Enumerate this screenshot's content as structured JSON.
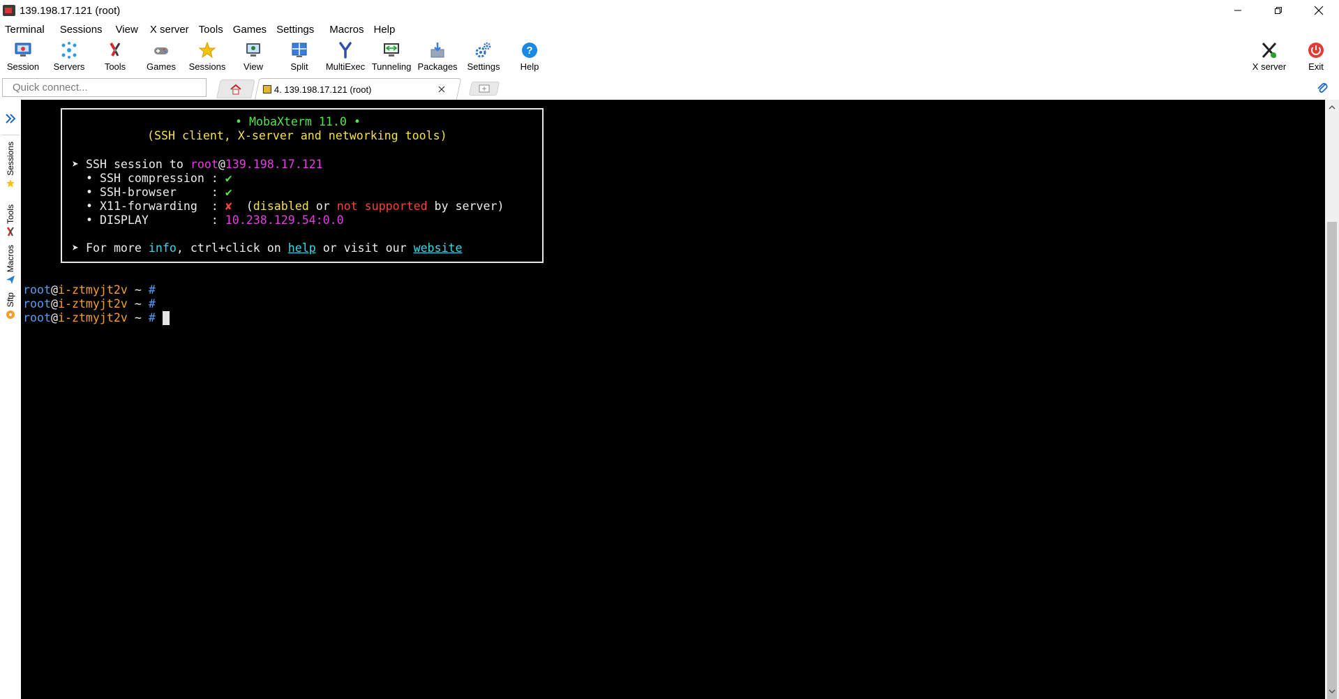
{
  "window": {
    "title": "139.198.17.121 (root)"
  },
  "menu": [
    "Terminal",
    "Sessions",
    "View",
    "X server",
    "Tools",
    "Games",
    "Settings",
    "Macros",
    "Help"
  ],
  "toolbar": {
    "left": [
      {
        "label": "Session",
        "icon": "session-icon"
      },
      {
        "label": "Servers",
        "icon": "servers-icon"
      },
      {
        "label": "Tools",
        "icon": "tools-icon"
      },
      {
        "label": "Games",
        "icon": "games-icon"
      },
      {
        "label": "Sessions",
        "icon": "star-icon"
      },
      {
        "label": "View",
        "icon": "view-icon"
      },
      {
        "label": "Split",
        "icon": "split-icon"
      },
      {
        "label": "MultiExec",
        "icon": "multiexec-icon"
      },
      {
        "label": "Tunneling",
        "icon": "tunneling-icon"
      },
      {
        "label": "Packages",
        "icon": "packages-icon"
      },
      {
        "label": "Settings",
        "icon": "settings-icon"
      },
      {
        "label": "Help",
        "icon": "help-icon"
      }
    ],
    "right": [
      {
        "label": "X server",
        "icon": "x-server-icon"
      },
      {
        "label": "Exit",
        "icon": "power-icon"
      }
    ]
  },
  "quick_connect": {
    "placeholder": "Quick connect..."
  },
  "tabs": {
    "active_title": "4. 139.198.17.121 (root)"
  },
  "sidebar": [
    "Sessions",
    "Tools",
    "Macros",
    "Sftp"
  ],
  "terminal": {
    "banner": {
      "title": "• MobaXterm 11.0 •",
      "subtitle": "(SSH client, X-server and networking tools)",
      "session_prefix": "➤ SSH session to ",
      "session_user": "root",
      "session_at": "@",
      "session_host": "139.198.17.121",
      "compression_label": "  • SSH compression : ",
      "compression_value": "✔",
      "browser_label": "  • SSH-browser     : ",
      "browser_value": "✔",
      "x11_label": "  • X11-forwarding  : ",
      "x11_value": "✘",
      "x11_note_open": "  (",
      "x11_note_disabled": "disabled",
      "x11_note_or": " or ",
      "x11_note_not_supported": "not supported",
      "x11_note_close": " by server)",
      "display_label": "  • DISPLAY         : ",
      "display_value": "10.238.129.54:0.0",
      "info_prefix": "➤ For more ",
      "info_word": "info",
      "info_mid": ", ctrl+click on ",
      "help_link": "help",
      "info_mid2": " or visit our ",
      "website_link": "website"
    },
    "prompt": {
      "user": "root",
      "at": "@",
      "host": "i-ztmyjt2v",
      "path": " ~ ",
      "symbol": "#"
    }
  },
  "colors": {
    "terminal_bg": "#000000",
    "green": "#55e34f",
    "yellow": "#f5e14a",
    "magenta": "#e040e0",
    "cyan": "#3fd6e6",
    "red": "#f0443c",
    "prompt_user": "#5b9bf0",
    "prompt_host": "#f0a030"
  }
}
